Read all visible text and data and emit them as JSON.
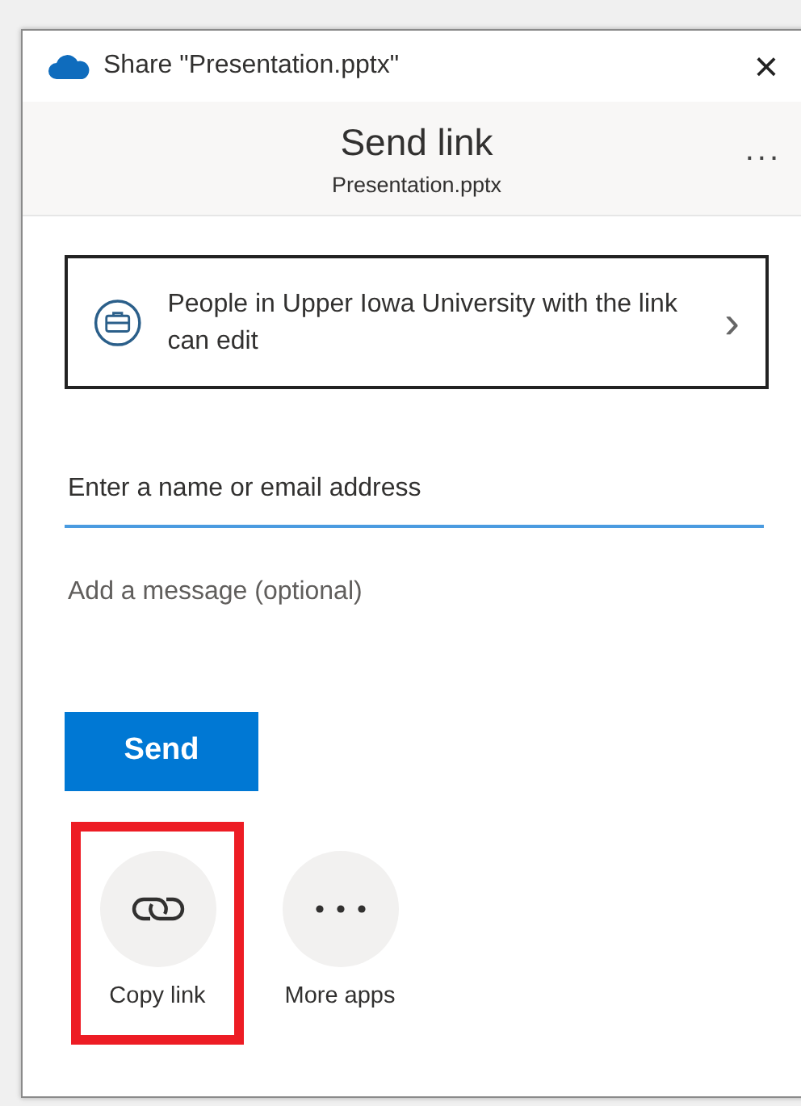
{
  "window": {
    "title": "Share \"Presentation.pptx\"",
    "close": "×"
  },
  "header": {
    "title": "Send link",
    "subtitle": "Presentation.pptx",
    "more": "..."
  },
  "permission": {
    "text": "People in Upper Iowa University with the link can edit",
    "chevron": "›"
  },
  "recipient": {
    "placeholder": "Enter a name or email address",
    "focused": true
  },
  "message": {
    "placeholder": "Add a message (optional)"
  },
  "send_button": "Send",
  "share_options": [
    {
      "kind": "link",
      "label": "Copy link",
      "highlighted": true
    },
    {
      "kind": "more",
      "label": "More apps",
      "highlighted": false
    }
  ]
}
